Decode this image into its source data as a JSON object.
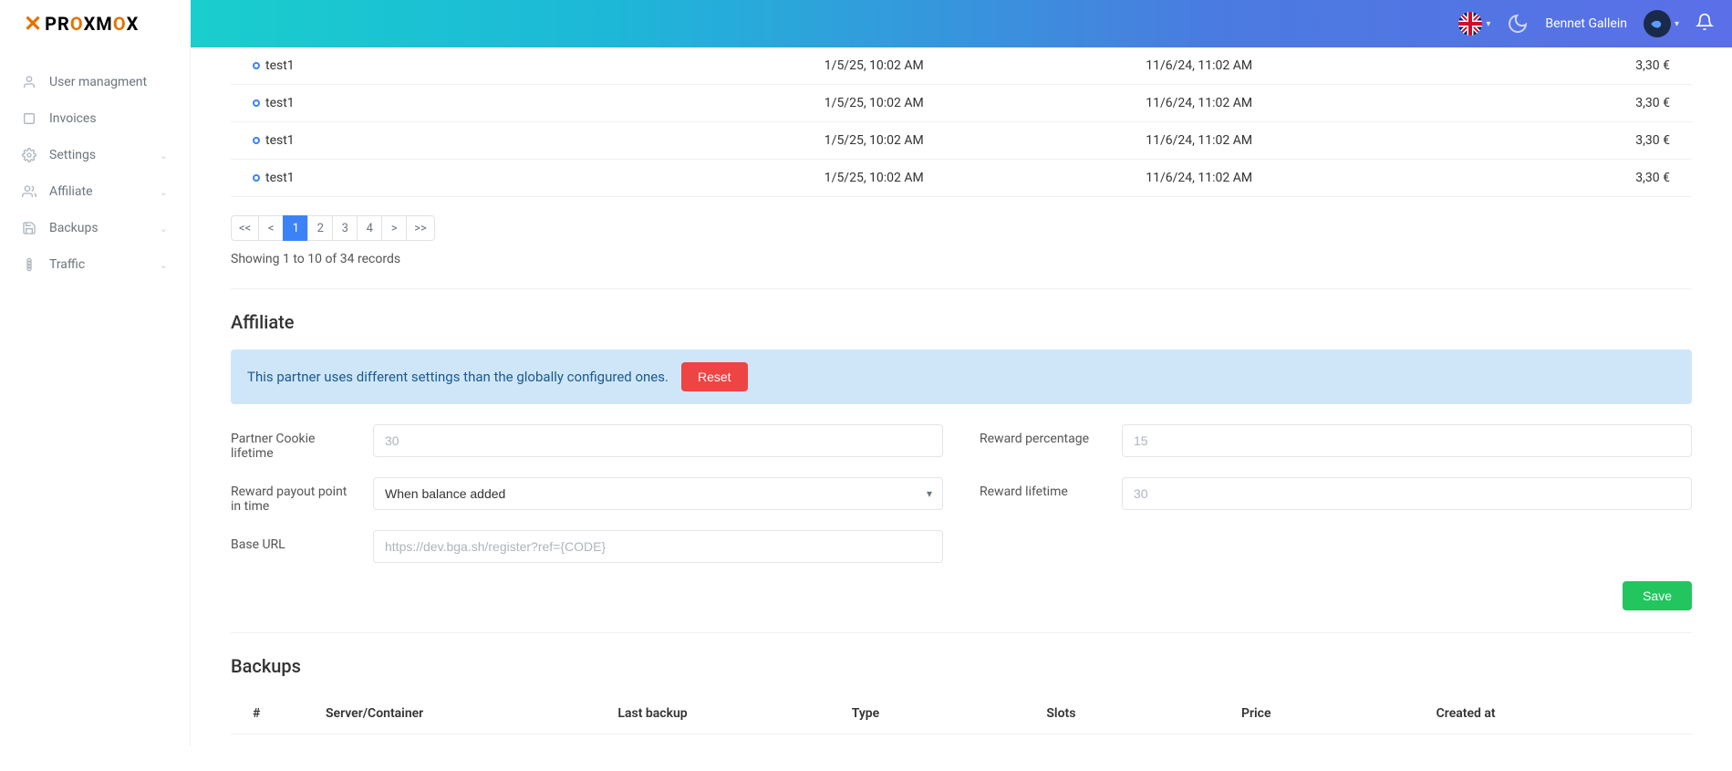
{
  "header": {
    "username": "Bennet Gallein"
  },
  "sidebar": {
    "items": [
      {
        "label": "User managment",
        "icon": "user",
        "expandable": false
      },
      {
        "label": "Invoices",
        "icon": "invoice",
        "expandable": false
      },
      {
        "label": "Settings",
        "icon": "gear",
        "expandable": true
      },
      {
        "label": "Affiliate",
        "icon": "users",
        "expandable": true
      },
      {
        "label": "Backups",
        "icon": "save",
        "expandable": true
      },
      {
        "label": "Traffic",
        "icon": "traffic",
        "expandable": true
      }
    ]
  },
  "table": {
    "rows": [
      {
        "name": "test1",
        "date1": "1/5/25, 10:02 AM",
        "date2": "11/6/24, 11:02 AM",
        "price": "3,30 €"
      },
      {
        "name": "test1",
        "date1": "1/5/25, 10:02 AM",
        "date2": "11/6/24, 11:02 AM",
        "price": "3,30 €"
      },
      {
        "name": "test1",
        "date1": "1/5/25, 10:02 AM",
        "date2": "11/6/24, 11:02 AM",
        "price": "3,30 €"
      },
      {
        "name": "test1",
        "date1": "1/5/25, 10:02 AM",
        "date2": "11/6/24, 11:02 AM",
        "price": "3,30 €"
      }
    ]
  },
  "pagination": {
    "first": "<<",
    "prev": "<",
    "pages": [
      "1",
      "2",
      "3",
      "4"
    ],
    "active": "1",
    "next": ">",
    "last": ">>",
    "info": "Showing 1 to 10 of 34 records"
  },
  "affiliate": {
    "title": "Affiliate",
    "alert_text": "This partner uses different settings than the globally configured ones.",
    "reset_label": "Reset",
    "save_label": "Save",
    "fields": {
      "cookie_lifetime_label": "Partner Cookie lifetime",
      "cookie_lifetime_placeholder": "30",
      "reward_percentage_label": "Reward percentage",
      "reward_percentage_placeholder": "15",
      "payout_point_label": "Reward payout point in time",
      "payout_point_value": "When balance added",
      "reward_lifetime_label": "Reward lifetime",
      "reward_lifetime_placeholder": "30",
      "base_url_label": "Base URL",
      "base_url_placeholder": "https://dev.bga.sh/register?ref={CODE}"
    }
  },
  "backups": {
    "title": "Backups",
    "columns": [
      "#",
      "Server/Container",
      "Last backup",
      "Type",
      "Slots",
      "Price",
      "Created at"
    ]
  }
}
